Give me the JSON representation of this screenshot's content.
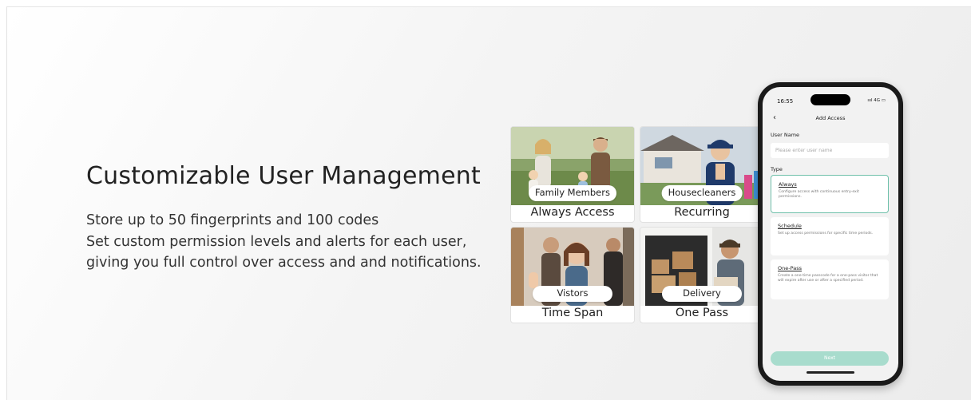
{
  "headline": "Customizable User Management",
  "description": [
    "Store up to 50 fingerprints and 100 codes",
    "Set custom permission levels and alerts for each user,",
    "giving you full control over access and and notifications."
  ],
  "cards": [
    {
      "tag": "Family Members",
      "caption": "Always Access"
    },
    {
      "tag": "Housecleaners",
      "caption": "Recurring"
    },
    {
      "tag": "Vistors",
      "caption": "Time Span"
    },
    {
      "tag": "Delivery",
      "caption": "One Pass"
    }
  ],
  "phone": {
    "time": "16:55",
    "status": "ıııl 4G ▭",
    "back_icon": "chevron-left-icon",
    "title": "Add Access",
    "user_name_label": "User Name",
    "user_name_placeholder": "Please enter user name",
    "type_label": "Type",
    "options": [
      {
        "name": "Always",
        "desc": "Configure access with continuous entry-exit permissions.",
        "selected": true
      },
      {
        "name": "Schedule",
        "desc": "Set up access permissions for specific time periods.",
        "selected": false
      },
      {
        "name": "One-Pass",
        "desc": "Create a one-time passcode for a one-pass visitor that will expire after use or after a specified period.",
        "selected": false
      }
    ],
    "next_label": "Next",
    "accent_color": "#6fc0aa",
    "button_color": "#a8dccd"
  }
}
